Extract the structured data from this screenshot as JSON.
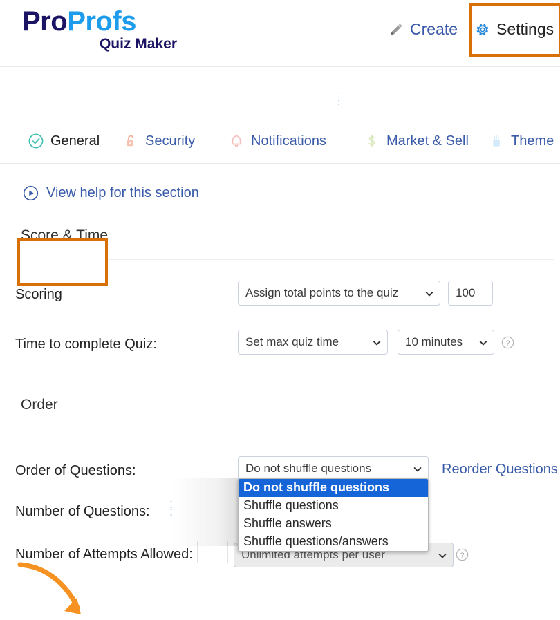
{
  "header": {
    "logo": {
      "part1": "Pro",
      "part2": "Profs",
      "subtitle": "Quiz Maker",
      "color_part1": "#1b1464",
      "color_part2": "#1c9ceb"
    },
    "create_label": "Create",
    "settings_label": "Settings",
    "create_icon": "pencil-icon",
    "settings_icon": "gear-icon",
    "highlight_color": "#d87007"
  },
  "tabs": [
    {
      "label": "General",
      "icon": "check-circle-icon",
      "active": true,
      "icon_color": "#45c0b5"
    },
    {
      "label": "Security",
      "icon": "lock-icon",
      "active": false,
      "icon_color": "#f7c4b4"
    },
    {
      "label": "Notifications",
      "icon": "bell-icon",
      "active": false,
      "icon_color": "#f7c4c4"
    },
    {
      "label": "Market & Sell",
      "icon": "dollar-icon",
      "active": false,
      "icon_color": "#dfeac4"
    },
    {
      "label": "Theme",
      "icon": "paint-icon",
      "active": false,
      "icon_color": "#cfe7f8"
    }
  ],
  "help": {
    "label": "View help for this section",
    "icon": "play-circle-icon"
  },
  "sections": {
    "score_time": {
      "title": "Score & Time"
    },
    "order": {
      "title": "Order"
    }
  },
  "fields": {
    "scoring": {
      "label": "Scoring",
      "select_value": "Assign total points to the quiz",
      "points_value": "100"
    },
    "time_to_complete": {
      "label": "Time to complete Quiz:",
      "mode_value": "Set max quiz time",
      "duration_value": "10 minutes",
      "help_icon": "question-mark-icon"
    },
    "order_of_questions": {
      "label": "Order of Questions:",
      "select_value": "Do not shuffle questions",
      "reorder_link": "Reorder Questions",
      "options": [
        "Do not shuffle questions",
        "Shuffle questions",
        "Shuffle answers",
        "Shuffle questions/answers"
      ],
      "selected_option_index": 0,
      "selected_bg": "#1565d8"
    },
    "number_of_questions": {
      "label": "Number of Questions:"
    },
    "number_of_attempts": {
      "label": "Number of Attempts Allowed:",
      "select_value": "Unlimited attempts per user",
      "disabled": true,
      "help_icon": "question-mark-icon"
    }
  },
  "annotations": {
    "arrow_color": "#f59222",
    "arrow_target": "order-of-questions-row"
  }
}
